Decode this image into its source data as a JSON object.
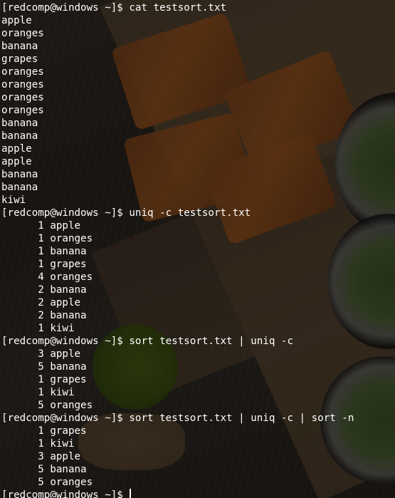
{
  "prompt": "[redcomp@windows ~]$ ",
  "blocks": [
    {
      "command": "cat testsort.txt",
      "output": [
        "apple",
        "oranges",
        "banana",
        "grapes",
        "oranges",
        "oranges",
        "oranges",
        "oranges",
        "banana",
        "banana",
        "apple",
        "apple",
        "banana",
        "banana",
        "kiwi"
      ]
    },
    {
      "command": "uniq -c testsort.txt",
      "output": [
        "      1 apple",
        "      1 oranges",
        "      1 banana",
        "      1 grapes",
        "      4 oranges",
        "      2 banana",
        "      2 apple",
        "      2 banana",
        "      1 kiwi"
      ]
    },
    {
      "command": "sort testsort.txt | uniq -c",
      "output": [
        "      3 apple",
        "      5 banana",
        "      1 grapes",
        "      1 kiwi",
        "      5 oranges"
      ]
    },
    {
      "command": "sort testsort.txt | uniq -c | sort -n",
      "output": [
        "      1 grapes",
        "      1 kiwi",
        "      3 apple",
        "      5 banana",
        "      5 oranges"
      ]
    }
  ],
  "current_command": ""
}
